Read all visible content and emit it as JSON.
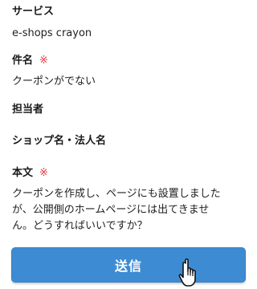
{
  "fields": {
    "service": {
      "label": "サービス",
      "value": "e-shops crayon"
    },
    "subject": {
      "label": "件名",
      "required_mark": "※",
      "value": "クーポンがでない"
    },
    "person": {
      "label": "担当者"
    },
    "shop": {
      "label": "ショップ名・法人名"
    },
    "body": {
      "label": "本文",
      "required_mark": "※",
      "lines": [
        "クーポンを作成し、ページにも設置しました",
        "が、公開側のホームページには出てきませ",
        "ん。どうすればいいですか？"
      ]
    }
  },
  "submit": {
    "label": "送信"
  },
  "colors": {
    "button": "#3d8bd3",
    "required": "#e8383d"
  },
  "icons": {
    "cursor": "hand-pointer-icon"
  }
}
